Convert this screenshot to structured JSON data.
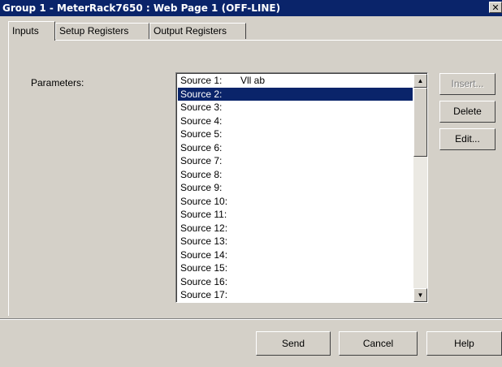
{
  "window": {
    "title": "Group 1 - MeterRack7650 : Web Page 1 (OFF-LINE)",
    "close_glyph": "✕"
  },
  "tabs": [
    {
      "label": "Inputs",
      "active": true
    },
    {
      "label": "Setup Registers",
      "active": false
    },
    {
      "label": "Output Registers",
      "active": false
    }
  ],
  "parameters": {
    "label": "Parameters:",
    "selected_index": 1,
    "items": [
      {
        "source": "Source 1:",
        "value": "Vll ab"
      },
      {
        "source": "Source 2:",
        "value": ""
      },
      {
        "source": "Source 3:",
        "value": ""
      },
      {
        "source": "Source 4:",
        "value": ""
      },
      {
        "source": "Source 5:",
        "value": ""
      },
      {
        "source": "Source 6:",
        "value": ""
      },
      {
        "source": "Source 7:",
        "value": ""
      },
      {
        "source": "Source 8:",
        "value": ""
      },
      {
        "source": "Source 9:",
        "value": ""
      },
      {
        "source": "Source 10:",
        "value": ""
      },
      {
        "source": "Source 11:",
        "value": ""
      },
      {
        "source": "Source 12:",
        "value": ""
      },
      {
        "source": "Source 13:",
        "value": ""
      },
      {
        "source": "Source 14:",
        "value": ""
      },
      {
        "source": "Source 15:",
        "value": ""
      },
      {
        "source": "Source 16:",
        "value": ""
      },
      {
        "source": "Source 17:",
        "value": ""
      }
    ]
  },
  "side_buttons": {
    "insert": "Insert...",
    "delete": "Delete",
    "edit": "Edit..."
  },
  "footer_buttons": {
    "send": "Send",
    "cancel": "Cancel",
    "help": "Help"
  },
  "colors": {
    "face": "#d4d0c8",
    "title_bar": "#0a246a",
    "selection": "#0a246a"
  }
}
